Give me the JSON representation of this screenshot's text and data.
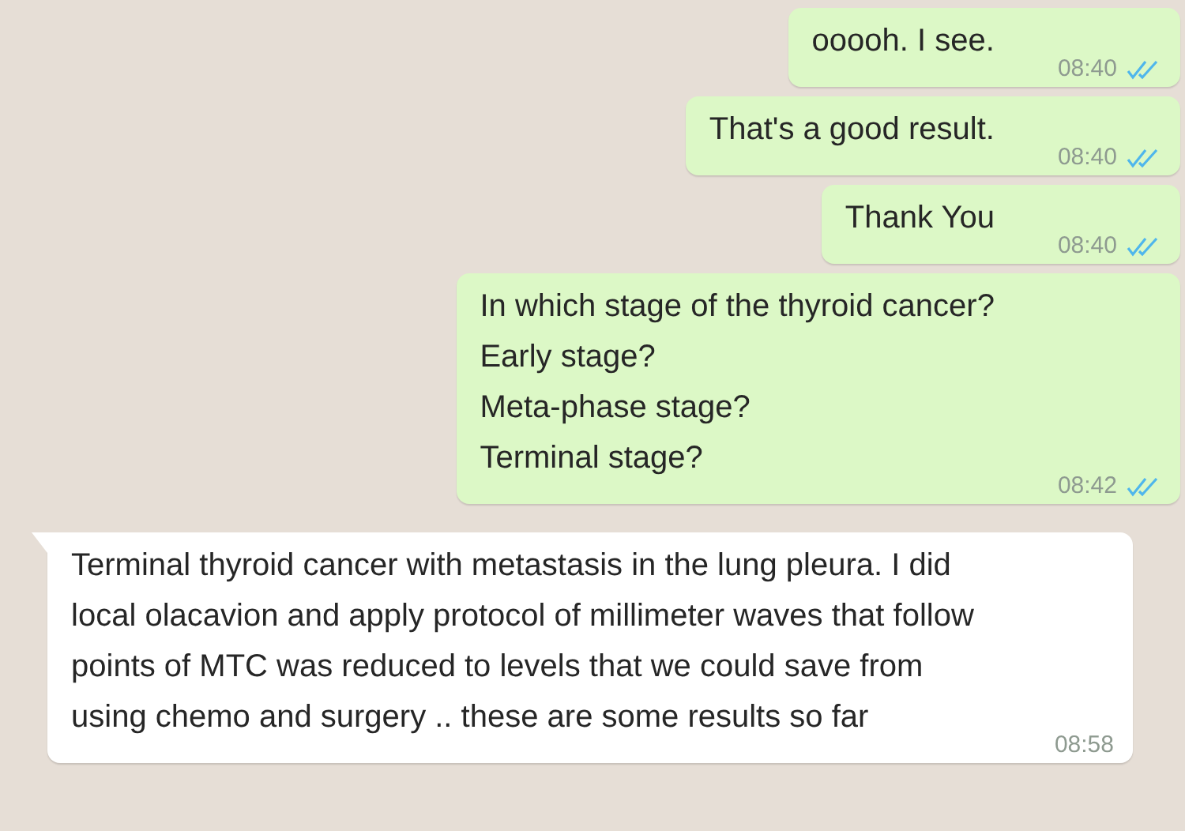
{
  "messages": [
    {
      "kind": "outgoing",
      "lines": [
        "ooooh. I see."
      ],
      "time": "08:40",
      "read": true
    },
    {
      "kind": "outgoing",
      "lines": [
        "That's a good result."
      ],
      "time": "08:40",
      "read": true
    },
    {
      "kind": "outgoing",
      "lines": [
        "Thank You"
      ],
      "time": "08:40",
      "read": true
    },
    {
      "kind": "outgoing",
      "lines": [
        "In which stage of the thyroid cancer?",
        "Early stage?",
        "Meta-phase stage?",
        "Terminal stage?"
      ],
      "time": "08:42",
      "read": true
    },
    {
      "kind": "incoming",
      "lines": [
        "Terminal thyroid cancer with metastasis in the lung pleura. I did local olacavion and apply protocol of millimeter waves that follow points of MTC was reduced to levels that we could save from using chemo and surgery .. these are some results so far"
      ],
      "time": "08:58"
    }
  ]
}
